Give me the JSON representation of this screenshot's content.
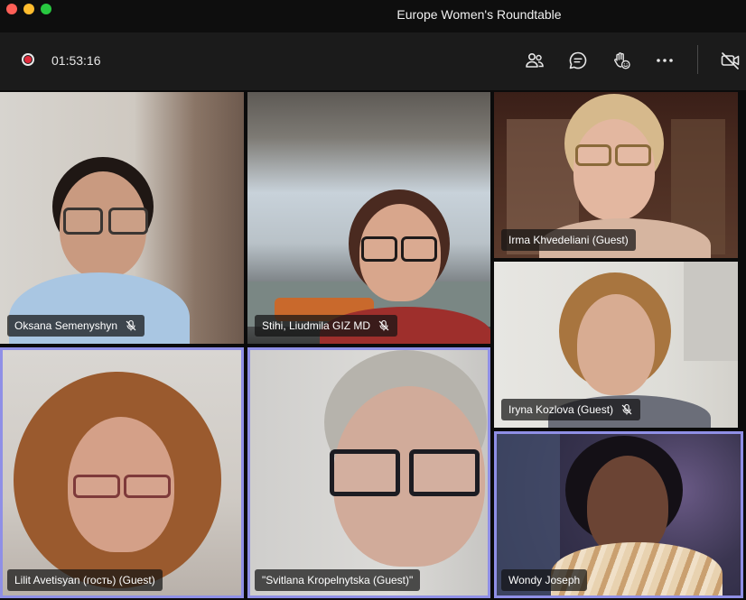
{
  "window": {
    "title": "Europe Women's Roundtable",
    "controls": [
      "close",
      "minimize",
      "zoom"
    ]
  },
  "toolbar": {
    "recording": true,
    "timer": "01:53:16",
    "icons": [
      "participants-icon",
      "chat-icon",
      "raise-hand-icon",
      "more-options-icon",
      "camera-off-icon"
    ]
  },
  "colors": {
    "active_speaker_border": "#8f8fe6",
    "record_red": "#e02b3c",
    "toolbar_bg": "#1b1b1b"
  },
  "participants": [
    {
      "name": "Oksana Semenyshyn",
      "muted": true,
      "active": false
    },
    {
      "name": "Stihi, Liudmila GIZ MD",
      "muted": true,
      "active": false
    },
    {
      "name": "Irma Khvedeliani (Guest)",
      "muted": false,
      "active": false
    },
    {
      "name": "Iryna Kozlova (Guest)",
      "muted": true,
      "active": false
    },
    {
      "name": "Lilit Avetisyan (гость) (Guest)",
      "muted": false,
      "active": true
    },
    {
      "name": "\"Svitlana Kropelnytska (Guest)\"",
      "muted": false,
      "active": true
    },
    {
      "name": "Wondy Joseph",
      "muted": false,
      "active": true
    }
  ]
}
